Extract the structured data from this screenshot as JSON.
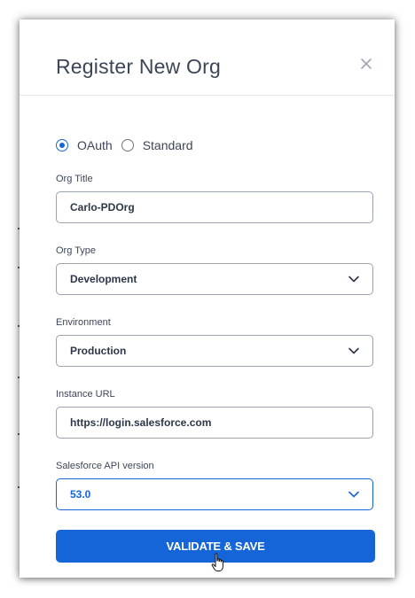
{
  "modal": {
    "title": "Register New Org",
    "close_icon": "close-icon"
  },
  "auth_type": {
    "options": [
      {
        "label": "OAuth",
        "selected": true
      },
      {
        "label": "Standard",
        "selected": false
      }
    ]
  },
  "fields": {
    "org_title": {
      "label": "Org Title",
      "value": "Carlo-PDOrg"
    },
    "org_type": {
      "label": "Org Type",
      "value": "Development"
    },
    "environment": {
      "label": "Environment",
      "value": "Production"
    },
    "instance_url": {
      "label": "Instance URL",
      "value": "https://login.salesforce.com"
    },
    "api_version": {
      "label": "Salesforce API version",
      "value": "53.0"
    }
  },
  "actions": {
    "validate_save_label": "VALIDATE & SAVE"
  },
  "colors": {
    "accent": "#1565d8",
    "text": "#3c4658",
    "border": "#9aa3af"
  }
}
